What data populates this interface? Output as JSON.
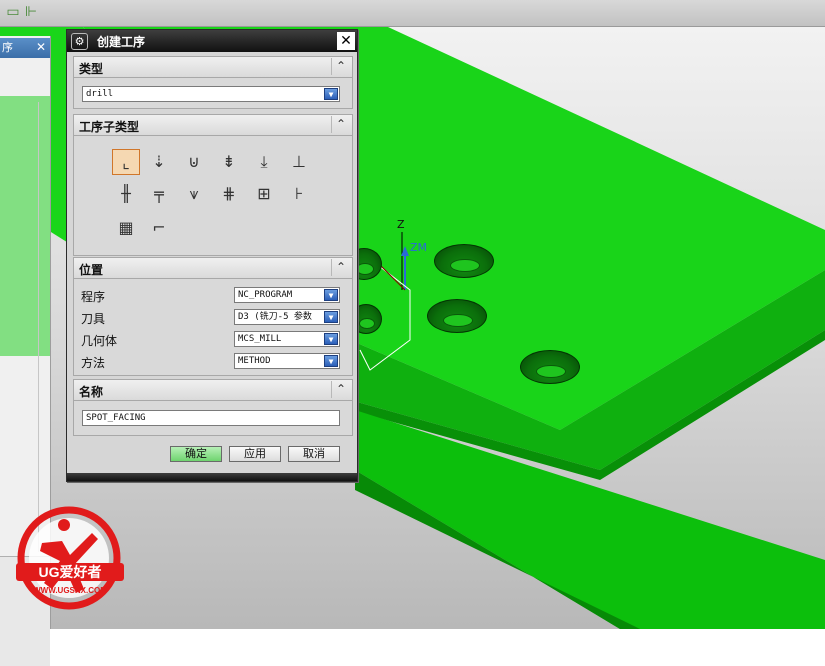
{
  "dialog": {
    "title": "创建工序",
    "close_glyph": "✕",
    "gear_glyph": "⚙"
  },
  "sections": {
    "type": {
      "label": "类型",
      "value": "drill"
    },
    "subtype": {
      "label": "工序子类型"
    },
    "location": {
      "label": "位置",
      "rows": [
        {
          "label": "程序",
          "value": "NC_PROGRAM"
        },
        {
          "label": "刀具",
          "value": "D3 (铣刀-5 参数"
        },
        {
          "label": "几何体",
          "value": "MCS_MILL"
        },
        {
          "label": "方法",
          "value": "METHOD"
        }
      ]
    },
    "name": {
      "label": "名称",
      "value": "SPOT_FACING"
    }
  },
  "buttons": {
    "ok": "确定",
    "apply": "应用",
    "cancel": "取消"
  },
  "nav": {
    "tab_label": "序"
  },
  "axes": {
    "z": "Z",
    "zm": "ZM"
  },
  "logo": {
    "brand": "UG爱好者",
    "url": "WWW.UGSNX.COM"
  },
  "colors": {
    "model_green": "#14d114",
    "dialog_titlebar": "#1c1c1c",
    "ok_button": "#7ad67a",
    "combo_arrow": "#3c70c8"
  },
  "icons": [
    "spot-facing-icon",
    "spot-drilling-icon",
    "drilling-icon",
    "peck-drilling-icon",
    "breakchip-drilling-icon",
    "boring-icon",
    "reaming-icon",
    "counterboring-icon",
    "countersinking-icon",
    "tapping-icon",
    "hole-milling-icon",
    "thread-milling-icon",
    "mill-control-icon",
    "mill-user-icon"
  ]
}
